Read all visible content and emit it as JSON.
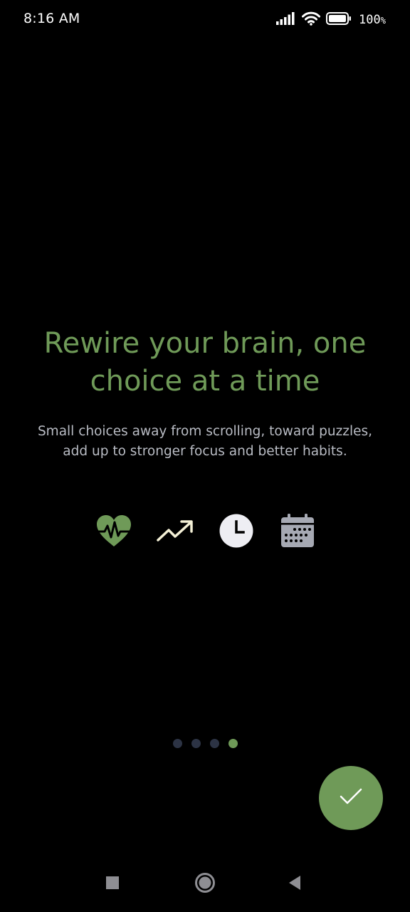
{
  "status_bar": {
    "time": "8:16 AM",
    "battery_percent": "100",
    "battery_symbol": "%",
    "icons": [
      "signal-icon",
      "wifi-icon",
      "battery-icon"
    ]
  },
  "onboarding": {
    "title": "Rewire your brain, one choice at a time",
    "description": "Small choices away from scrolling, toward puzzles, add up to stronger focus and better habits.",
    "feature_icons": [
      "heart-pulse-icon",
      "trending-up-icon",
      "clock-icon",
      "calendar-icon"
    ],
    "page_count": 4,
    "current_page": 4
  },
  "actions": {
    "finish_icon": "checkmark-icon"
  },
  "navigation": {
    "buttons": [
      "recents-square-icon",
      "home-circle-icon",
      "back-triangle-icon"
    ]
  },
  "colors": {
    "background": "#000000",
    "accent": "#6f9a58",
    "text_secondary": "#b9bcc4",
    "inactive_dot": "#2c3344",
    "heart": "#6f9a58",
    "trend_arrow": "#f4f0d6",
    "clock_face": "#eeeef3",
    "calendar": "#a6a9b3"
  }
}
